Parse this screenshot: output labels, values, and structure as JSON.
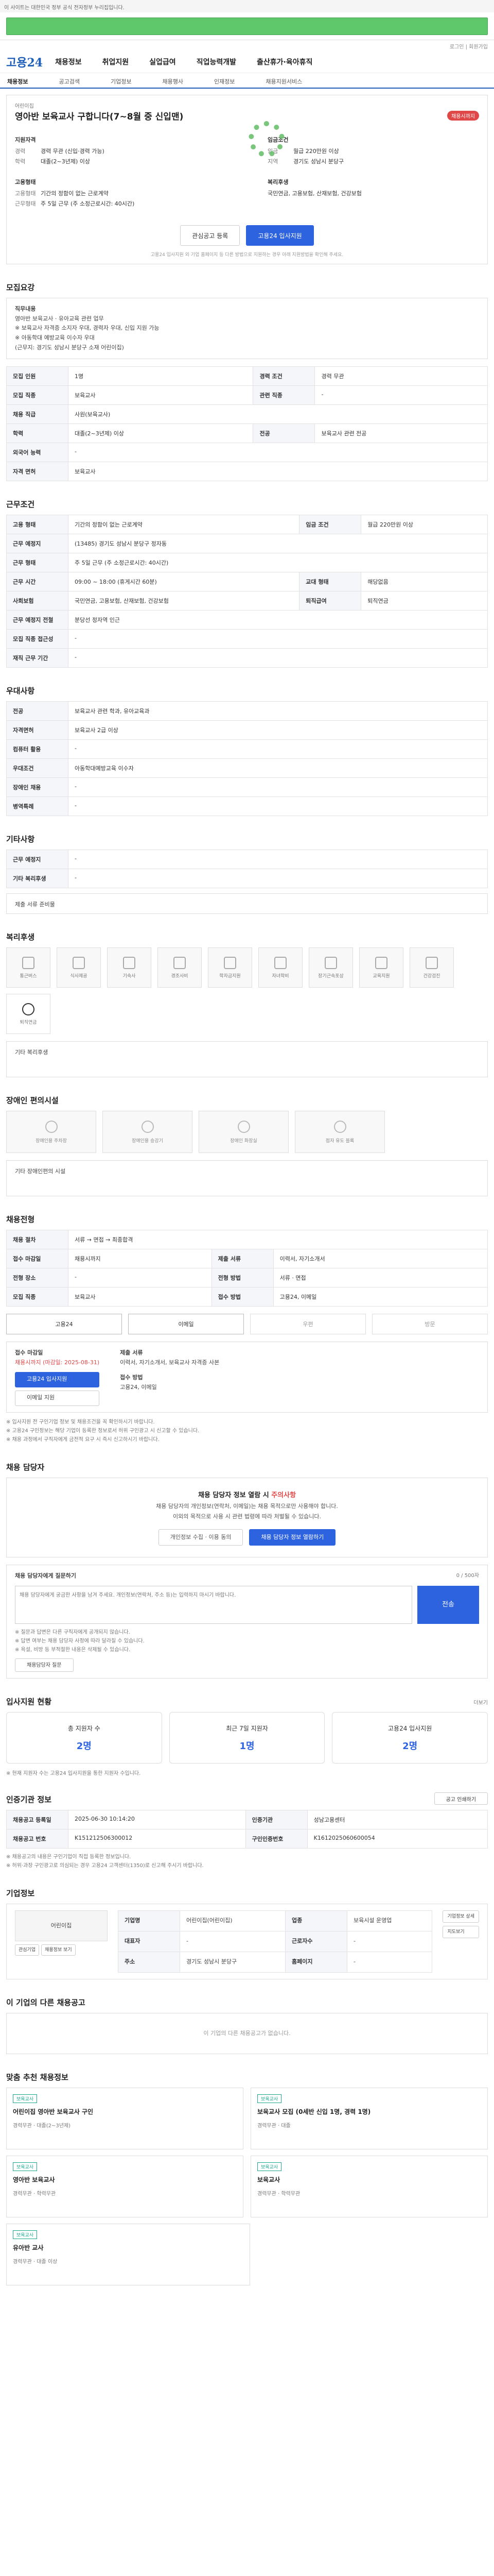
{
  "topbar": {
    "text": "이 사이트는 대한민국 정부 공식 전자정부 누리집입니다."
  },
  "links": {
    "text": "로그인 | 회원가입"
  },
  "header": {
    "logo": "고용24",
    "nav": [
      "채용정보",
      "취업지원",
      "실업급여",
      "직업능력개발",
      "출산휴가·육아휴직"
    ]
  },
  "subnav": [
    "채용정보",
    "공고검색",
    "기업정보",
    "채용행사",
    "인재정보",
    "채용지원서비스"
  ],
  "job": {
    "company_label": "어린이집",
    "title": "영아반 보육교사 구합니다(7~8월 중 신입맨)",
    "badge": "채용시까지",
    "left_label": "지원자격",
    "career_k": "경력",
    "career_v": "경력 무관 (신입·경력 가능)",
    "edu_k": "학력",
    "edu_v": "대졸(2~3년제) 이상",
    "cond_label": "고용형태",
    "emp_k": "고용형태",
    "emp_v": "기간의 정함이 없는 근로계약",
    "hours_k": "근무형태",
    "hours_v": "주 5일 근무 (주 소정근로시간: 40시간)",
    "right_label": "임금조건",
    "pay_k": "임금",
    "pay_v": "월급 220만원 이상",
    "place_k": "지역",
    "place_v": "경기도 성남시 분당구",
    "welfare_label": "복리후생",
    "welfare_v": "국민연금, 고용보험, 산재보험, 건강보험",
    "btn_interest": "관심공고 등록",
    "btn_apply": "고용24 입사지원",
    "note": "고용24 입사지원 외 기업 홈페이지 등 다른 방법으로 지원하는 경우 아래 지원방법을 확인해 주세요."
  },
  "sections": {
    "summary": "모집요강",
    "conditions": "근무조건",
    "welfare": "우대사항",
    "etc": "기타사항",
    "benefits": "복리후생",
    "disability": "장애인 편의시설",
    "hiring": "채용전형",
    "contact": "채용 담당자",
    "applicants": "입사지원 현황",
    "info": "인증기관 정보",
    "company": "기업정보",
    "related": "이 기업의 다른 채용공고",
    "recommend": "맞춤 추천 채용정보"
  },
  "summary": {
    "role_label": "직무내용",
    "text1": "영아반 보육교사 · 유아교육 관련 업무",
    "text2": "※ 보육교사 자격증 소지자 우대, 경력자 우대, 신입 지원 가능",
    "text3": "※ 아동학대 예방교육 이수자 우대",
    "text4": "(근무지: 경기도 성남시 분당구 소재 어린이집)"
  },
  "summary_table": [
    {
      "k": "모집 인원",
      "v": "1명",
      "k2": "경력 조건",
      "v2": "경력 무관"
    },
    {
      "k": "모집 직종",
      "v": "보육교사",
      "k2": "관련 직종",
      "v2": "-"
    },
    {
      "k": "채용 직급",
      "v": "사원(보육교사)",
      "k2": "",
      "v2": ""
    },
    {
      "k": "학력",
      "v": "대졸(2~3년제) 이상",
      "k2": "전공",
      "v2": "보육교사 관련 전공"
    },
    {
      "k": "외국어 능력",
      "v": "-",
      "k2": "",
      "v2": ""
    },
    {
      "k": "자격 면허",
      "v": "보육교사",
      "k2": "",
      "v2": ""
    }
  ],
  "cond_table": [
    {
      "k": "고용 형태",
      "v": "기간의 정함이 없는 근로계약",
      "k2": "임금 조건",
      "v2": "월급 220만원 이상"
    },
    {
      "k": "근무 예정지",
      "v": "(13485) 경기도 성남시 분당구 정자동",
      "k2": "",
      "v2": ""
    },
    {
      "k": "근무 형태",
      "v": "주 5일 근무 (주 소정근로시간: 40시간)",
      "k2": "",
      "v2": ""
    },
    {
      "k": "근무 시간",
      "v": "09:00 ~ 18:00 (휴게시간 60분)",
      "k2": "교대 형태",
      "v2": "해당없음"
    },
    {
      "k": "사회보험",
      "v": "국민연금, 고용보험, 산재보험, 건강보험",
      "k2": "퇴직급여",
      "v2": "퇴직연금"
    },
    {
      "k": "근무 예정지 전철",
      "v": "분당선 정자역 인근",
      "k2": "",
      "v2": ""
    },
    {
      "k": "모집 직종 접근성",
      "v": "-",
      "k2": "",
      "v2": ""
    },
    {
      "k": "재직 근무 기간",
      "v": "-",
      "k2": "",
      "v2": ""
    }
  ],
  "pref_table": [
    {
      "k": "전공",
      "v": "보육교사 관련 학과, 유아교육과"
    },
    {
      "k": "자격면허",
      "v": "보육교사 2급 이상"
    },
    {
      "k": "컴퓨터 활용",
      "v": "-"
    },
    {
      "k": "우대조건",
      "v": "아동학대예방교육 이수자"
    },
    {
      "k": "장애인 채용",
      "v": "-"
    },
    {
      "k": "병역특례",
      "v": "-"
    }
  ],
  "etc_table": [
    {
      "k": "근무 예정지",
      "v": "-"
    },
    {
      "k": "기타 복리후생",
      "v": "-"
    }
  ],
  "etc_more": "제출 서류 준비물",
  "benefit_icons": [
    "통근버스",
    "식사제공",
    "기숙사",
    "경조사비",
    "학자금지원",
    "자녀학비",
    "장기근속포상",
    "교육지원",
    "건강검진",
    "퇴직연금"
  ],
  "benefit_other": "기타 복리후생",
  "disability_icons": [
    "장애인용 주차장",
    "장애인용 승강기",
    "장애인 화장실",
    "점자 유도 블록"
  ],
  "disability_other": "기타 장애인편의 시설",
  "hiring_table": [
    {
      "k": "채용 절차",
      "v": "서류 → 면접 → 최종합격",
      "k2": "",
      "v2": ""
    },
    {
      "k": "접수 마감일",
      "v": "채용시까지",
      "k2": "제출 서류",
      "v2": "이력서, 자기소개서"
    },
    {
      "k": "전형 장소",
      "v": "-",
      "k2": "전형 방법",
      "v2": "서류 · 면접"
    },
    {
      "k": "모집 직종",
      "v": "보육교사",
      "k2": "접수 방법",
      "v2": "고용24, 이메일"
    }
  ],
  "hiring_methods": [
    "고용24",
    "이메일",
    "우편",
    "방문"
  ],
  "apply": {
    "deadline_label": "접수 마감일",
    "deadline": "채용시까지 (마감일: 2025-08-31)",
    "btn": "고용24 입사지원",
    "btn2": "이메일 지원",
    "docs_label": "제출 서류",
    "docs": "이력서, 자기소개서, 보육교사 자격증 사본",
    "method_label": "접수 방법",
    "method": "고용24, 이메일"
  },
  "notices": [
    "※ 입사지원 전 구인기업 정보 및 채용조건을 꼭 확인하시기 바랍니다.",
    "※ 고용24 구인정보는 해당 기업이 등록한 정보로서 허위 구인광고 시 신고할 수 있습니다.",
    "※ 채용 과정에서 구직자에게 금전적 요구 시 즉시 신고하시기 바랍니다."
  ],
  "contact": {
    "head_pre": "채용 담당자 정보 열람 시 ",
    "head_red": "주의사항",
    "line1": "채용 담당자의 개인정보(연락처, 이메일)는 채용 목적으로만 사용해야 합니다.",
    "line2": "이외의 목적으로 사용 시 관련 법령에 따라 처벌될 수 있습니다.",
    "btn1": "개인정보 수집 · 이용 동의",
    "btn2": "채용 담당자 정보 열람하기",
    "q_label": "채용 담당자에게 질문하기",
    "q_placeholder": "채용 담당자에게 궁금한 사항을 남겨 주세요. 개인정보(연락처, 주소 등)는 입력하지 마시기 바랍니다.",
    "q_count": "0 / 500자",
    "q_send": "전송",
    "q_notes": [
      "※ 질문과 답변은 다른 구직자에게 공개되지 않습니다.",
      "※ 답변 여부는 채용 담당자 사정에 따라 달라질 수 있습니다.",
      "※ 욕설, 비방 등 부적절한 내용은 삭제될 수 있습니다."
    ],
    "q_btn": "채용담당자 질문"
  },
  "stats": {
    "more": "더보기",
    "items": [
      {
        "label": "총 지원자 수",
        "value": "2명"
      },
      {
        "label": "최근 7일 지원자",
        "value": "1명"
      },
      {
        "label": "고용24 입사지원",
        "value": "2명"
      }
    ],
    "note": "※ 현재 지원자 수는 고용24 입사지원을 통한 지원자 수입니다."
  },
  "info": {
    "print": "공고 인쇄하기",
    "rows": [
      {
        "k": "채용공고 등록일",
        "v": "2025-06-30 10:14:20",
        "k2": "인증기관",
        "v2": "성남고용센터"
      },
      {
        "k": "채용공고 번호",
        "v": "K151212506300012",
        "k2": "구인인증번호",
        "v2": "K1612025060600054"
      }
    ],
    "notes": [
      "※ 채용공고의 내용은 구인기업이 직접 등록한 정보입니다.",
      "※ 허위·과장 구인광고로 의심되는 경우 고용24 고객센터(1350)로 신고해 주시기 바랍니다."
    ]
  },
  "company": {
    "name": "어린이집",
    "rows": [
      {
        "k": "기업명",
        "v": "어린이집(어린이집)",
        "k2": "업종",
        "v2": "보육시설 운영업"
      },
      {
        "k": "대표자",
        "v": "-",
        "k2": "근로자수",
        "v2": "-"
      },
      {
        "k": "주소",
        "v": "경기도 성남시 분당구",
        "k2": "홈페이지",
        "v2": "-"
      }
    ],
    "btn1": "관심기업",
    "btn2": "채용정보 보기",
    "btn_a": "기업정보 상세",
    "btn_b": "지도보기"
  },
  "related": {
    "empty": "이 기업의 다른 채용공고가 없습니다."
  },
  "recommend": {
    "cards": [
      {
        "tag": "보육교사",
        "title": "어린이집 영아반 보육교사 구인",
        "info1": "경력무관",
        "info2": "대졸(2~3년제)"
      },
      {
        "tag": "보육교사",
        "title": "보육교사 모집 (0세반 신입 1명, 경력 1명)",
        "info1": "경력무관",
        "info2": "대졸"
      },
      {
        "tag": "보육교사",
        "title": "영아반 보육교사",
        "info1": "경력무관",
        "info2": "학력무관"
      },
      {
        "tag": "보육교사",
        "title": "보육교사",
        "info1": "경력무관",
        "info2": "학력무관"
      },
      {
        "tag": "보육교사",
        "title": "유아반 교사",
        "info1": "경력무관",
        "info2": "대졸 이상"
      }
    ]
  }
}
